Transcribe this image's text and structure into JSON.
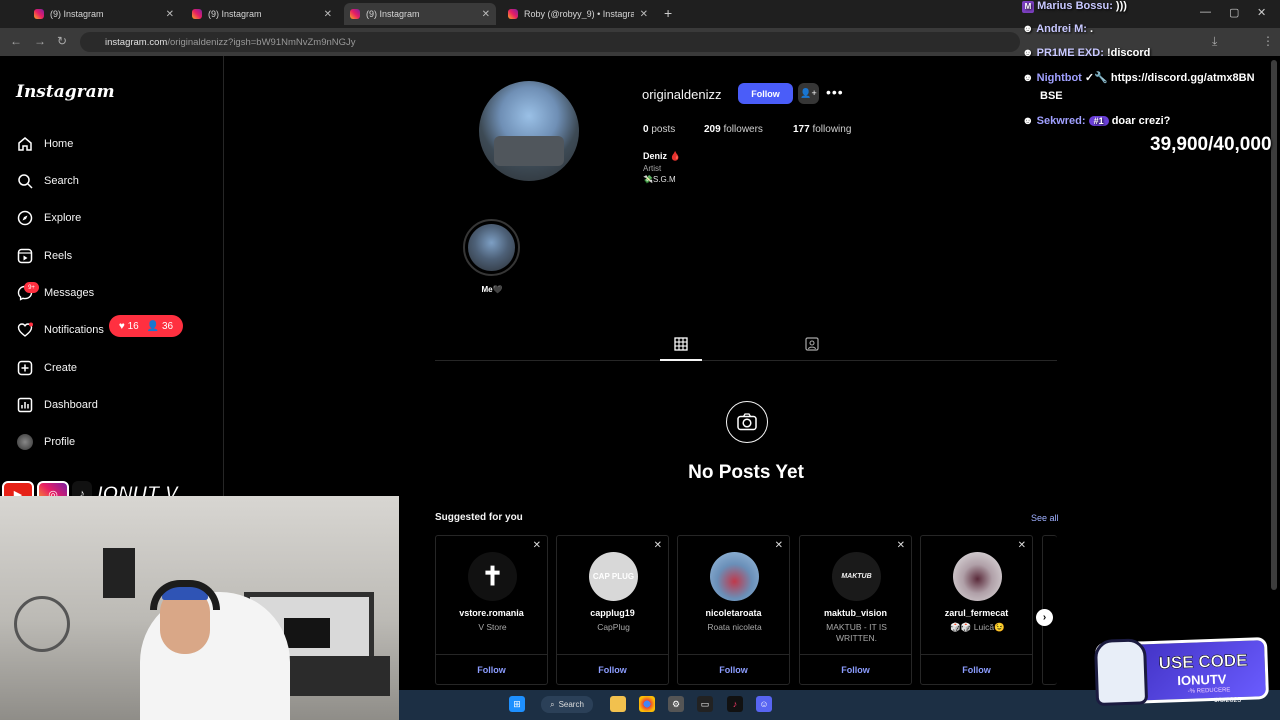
{
  "browser": {
    "tabs": [
      {
        "title": "(9) Instagram",
        "active": false
      },
      {
        "title": "(9) Instagram",
        "active": false
      },
      {
        "title": "(9) Instagram",
        "active": true
      },
      {
        "title": "Roby (@robyy_9) • Instagram p",
        "active": false
      }
    ],
    "url_host": "instagram.com",
    "url_path": "/originaldenizz?igsh=bW91NmNvZm9nNGJy"
  },
  "sidebar": {
    "logo": "Instagram",
    "items": [
      {
        "label": "Home",
        "icon": "home-icon"
      },
      {
        "label": "Search",
        "icon": "search-icon"
      },
      {
        "label": "Explore",
        "icon": "compass-icon"
      },
      {
        "label": "Reels",
        "icon": "reels-icon"
      },
      {
        "label": "Messages",
        "icon": "messenger-icon"
      },
      {
        "label": "Notifications",
        "icon": "heart-icon"
      },
      {
        "label": "Create",
        "icon": "plus-square-icon"
      },
      {
        "label": "Dashboard",
        "icon": "chart-icon"
      },
      {
        "label": "Profile",
        "icon": "avatar-icon"
      }
    ],
    "messages_badge": "9+",
    "notif_likes": "16",
    "notif_follows": "36"
  },
  "profile": {
    "username": "originaldenizz",
    "follow_label": "Follow",
    "posts_count": "0",
    "posts_label": "posts",
    "followers_count": "209",
    "followers_label": "followers",
    "following_count": "177",
    "following_label": "following",
    "bio_name": "Deniz 🩸",
    "bio_category": "Artist",
    "bio_text": "💸S.G.M",
    "highlight_label": "Me🖤",
    "empty_title": "No Posts Yet"
  },
  "suggested": {
    "title": "Suggested for you",
    "see_all": "See all",
    "follow_label": "Follow",
    "cards": [
      {
        "username": "vstore.romania",
        "subtitle": "V Store",
        "avatar_bg": "#111111",
        "avatar_text": "✝"
      },
      {
        "username": "capplug19",
        "subtitle": "CapPlug",
        "avatar_bg": "#d8d8d8",
        "avatar_text": "CAP PLUG"
      },
      {
        "username": "nicoletaroata",
        "subtitle": "Roata nicoleta",
        "avatar_bg": "#6a8fb8",
        "avatar_text": ""
      },
      {
        "username": "maktub_vision",
        "subtitle": "MAKTUB - IT IS WRITTEN.",
        "avatar_bg": "#1a1a1a",
        "avatar_text": "MAKTUB"
      },
      {
        "username": "zarul_fermecat",
        "subtitle": "🎲🎲 Luică😉",
        "avatar_bg": "#e6e6e6",
        "avatar_text": ""
      }
    ]
  },
  "chat": [
    {
      "user": "Marius Bossu:",
      "msg": ")))"
    },
    {
      "user": "Andrei M:",
      "msg": "."
    },
    {
      "user": "PR1ME EXD:",
      "msg": "!discord"
    },
    {
      "user": "Nightbot",
      "msg": "https://discord.gg/atmx8BN"
    },
    {
      "user": "",
      "msg": "BSE"
    },
    {
      "user": "Sekwred:",
      "msg": "doar crezi?"
    }
  ],
  "chat_badge": "#1",
  "goal": "39,900/40,000",
  "overlay": {
    "brand": "IONUT V",
    "promo_line1": "USE CODE",
    "promo_line2": "IONUTV",
    "promo_line3": "-% REDUCERE"
  },
  "taskbar": {
    "search_label": "Search",
    "date": "9/5/2025"
  },
  "colors": {
    "follow_blue": "#4a5df9",
    "notif_red": "#ff3040",
    "link_blue": "#8c9dff"
  }
}
